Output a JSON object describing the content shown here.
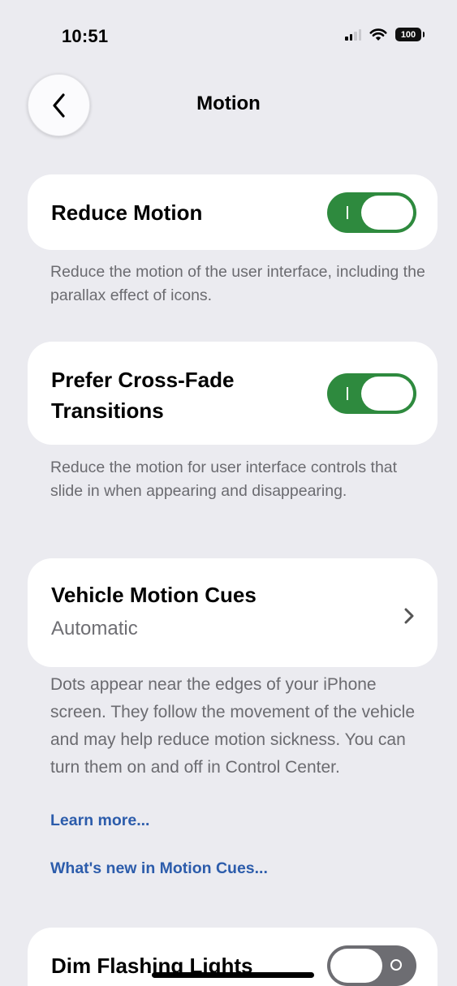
{
  "status_bar": {
    "time": "10:51",
    "battery": "100",
    "signal_icon": "cellular-signal-icon",
    "wifi_icon": "wifi-icon"
  },
  "nav": {
    "back_icon": "chevron-left-icon",
    "title": "Motion"
  },
  "reduce_motion": {
    "label": "Reduce Motion",
    "enabled": true,
    "footer": "Reduce the motion of the user interface, including the parallax effect of icons."
  },
  "cross_fade": {
    "label_line1": "Prefer Cross-Fade",
    "label_line2": "Transitions",
    "enabled": true,
    "footer": "Reduce the motion for user interface controls that slide in when appearing and disappearing."
  },
  "vehicle_motion_cues": {
    "label": "Vehicle Motion Cues",
    "value": "Automatic",
    "chevron_icon": "chevron-right-icon",
    "footer": "Dots appear near the edges of your iPhone screen. They follow the movement of the vehicle and may help reduce motion sickness. You can turn them on and off in Control Center.",
    "learn_more": "Learn more...",
    "whats_new": "What's new in Motion Cues..."
  },
  "dim_flashing_lights": {
    "label": "Dim Flashing Lights",
    "enabled": false
  },
  "colors": {
    "background": "#ebebf0",
    "toggle_on": "#2e8a3e",
    "toggle_off": "#6d6d72",
    "link": "#2c5cab",
    "secondary_text": "#6b6b70"
  }
}
